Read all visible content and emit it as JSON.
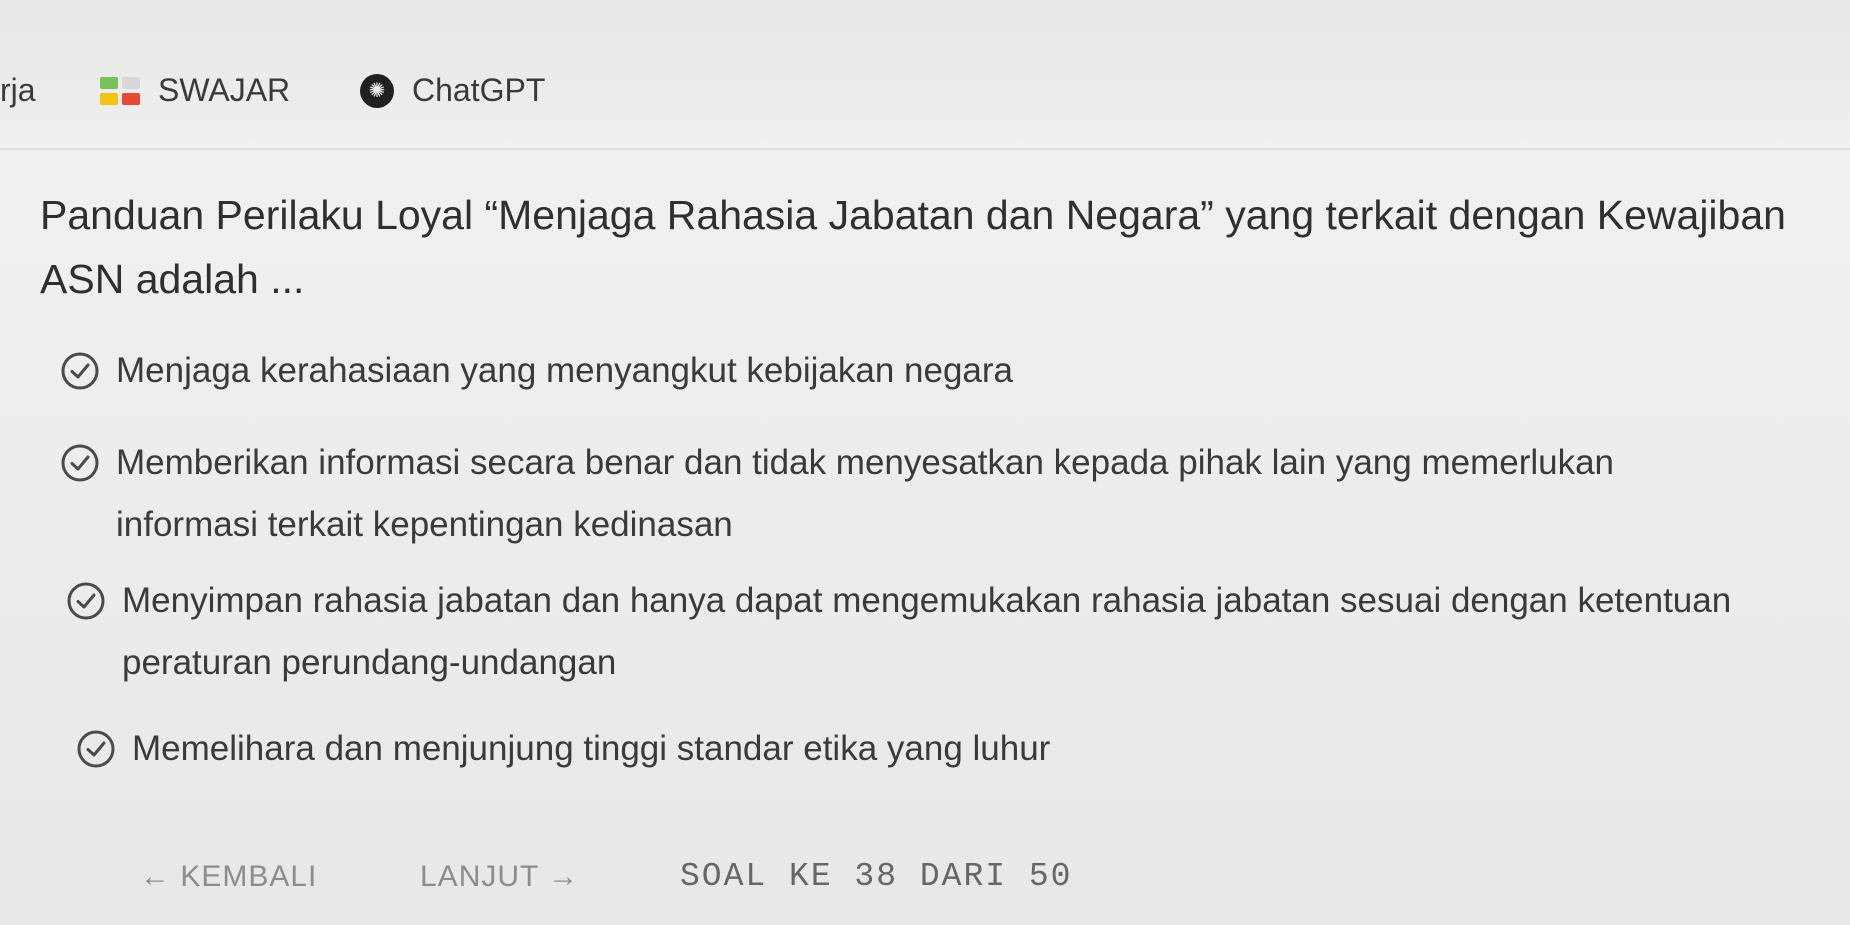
{
  "bookmarks": {
    "items": [
      {
        "label": "rja",
        "icon": "truncated"
      },
      {
        "label": "SWAJAR",
        "icon": "swajar-grid-icon"
      },
      {
        "label": "ChatGPT",
        "icon": "chatgpt-logo-icon"
      }
    ]
  },
  "quiz": {
    "question": "Panduan Perilaku Loyal “Menjaga Rahasia Jabatan dan Negara” yang terkait dengan Kewajiban ASN adalah ...",
    "options": [
      {
        "text": "Menjaga kerahasiaan yang menyangkut kebijakan negara"
      },
      {
        "text": "Memberikan informasi secara benar dan tidak menyesatkan kepada pihak lain yang memerlukan informasi terkait kepentingan kedinasan"
      },
      {
        "text": "Menyimpan rahasia jabatan dan hanya dapat mengemukakan rahasia jabatan sesuai dengan ketentuan peraturan perundang-undangan"
      },
      {
        "text": "Memelihara dan menjunjung tinggi standar etika yang luhur"
      }
    ],
    "option_icon": "check-circle-icon"
  },
  "nav": {
    "back_label": "← KEMBALI",
    "next_label": "LANJUT →",
    "counter": "SOAL KE 38 DARI 50"
  },
  "colors": {
    "text": "#2f2f2f",
    "muted": "#8c8c8c",
    "check": "#4a4a4a"
  }
}
